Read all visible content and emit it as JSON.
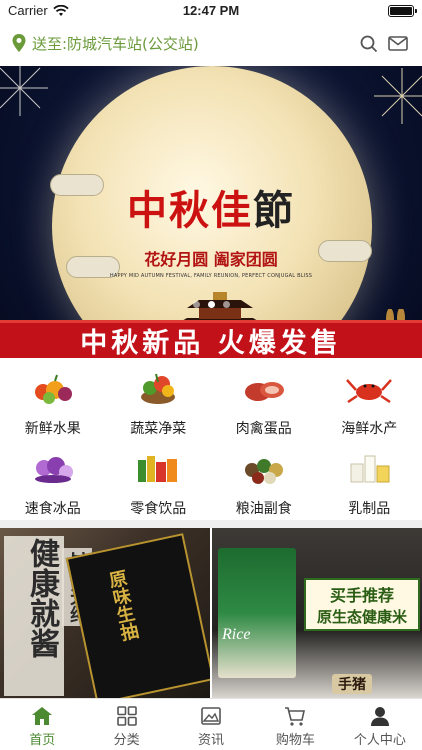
{
  "status": {
    "carrier": "Carrier",
    "time": "12:47 PM",
    "battery_level": 1.0
  },
  "header": {
    "location": "送至:防城汽车站(公交站)",
    "location_color": "#6a9a3a",
    "icons": [
      "location-pin-icon",
      "search-icon",
      "mail-icon"
    ]
  },
  "banner": {
    "title_main": "中秋佳",
    "title_tail": "節",
    "subtitle": "花好月圆 阖家团圆",
    "english": "HAPPY MID AUTUMN FESTIVAL, FAMILY REUNION, PERFECT CONJUGAL BLISS",
    "ribbon": "中秋新品 火爆发售",
    "slides": 3,
    "active_slide": 2
  },
  "categories": [
    {
      "label": "新鲜水果",
      "icon": "fruit-icon"
    },
    {
      "label": "蔬菜净菜",
      "icon": "vegetable-icon"
    },
    {
      "label": "肉禽蛋品",
      "icon": "meat-icon"
    },
    {
      "label": "海鲜水产",
      "icon": "seafood-icon"
    },
    {
      "label": "速食冰品",
      "icon": "ice-cream-icon"
    },
    {
      "label": "零食饮品",
      "icon": "snack-icon"
    },
    {
      "label": "粮油副食",
      "icon": "grain-icon"
    },
    {
      "label": "乳制品",
      "icon": "dairy-icon"
    }
  ],
  "promos": {
    "left": {
      "vertical_text": "健康就酱",
      "side_text": "180天纯",
      "box_text": "原味生抽"
    },
    "right": {
      "bag_text": "Rice",
      "headline_1": "买手推荐",
      "headline_2": "原生态健康米",
      "tag": "手猪"
    }
  },
  "tabbar": {
    "items": [
      {
        "label": "首页",
        "icon": "home-icon",
        "active": true
      },
      {
        "label": "分类",
        "icon": "grid-icon",
        "active": false
      },
      {
        "label": "资讯",
        "icon": "news-icon",
        "active": false
      },
      {
        "label": "购物车",
        "icon": "cart-icon",
        "active": false
      },
      {
        "label": "个人中心",
        "icon": "user-icon",
        "active": false
      }
    ],
    "active_color": "#4c8a32"
  }
}
